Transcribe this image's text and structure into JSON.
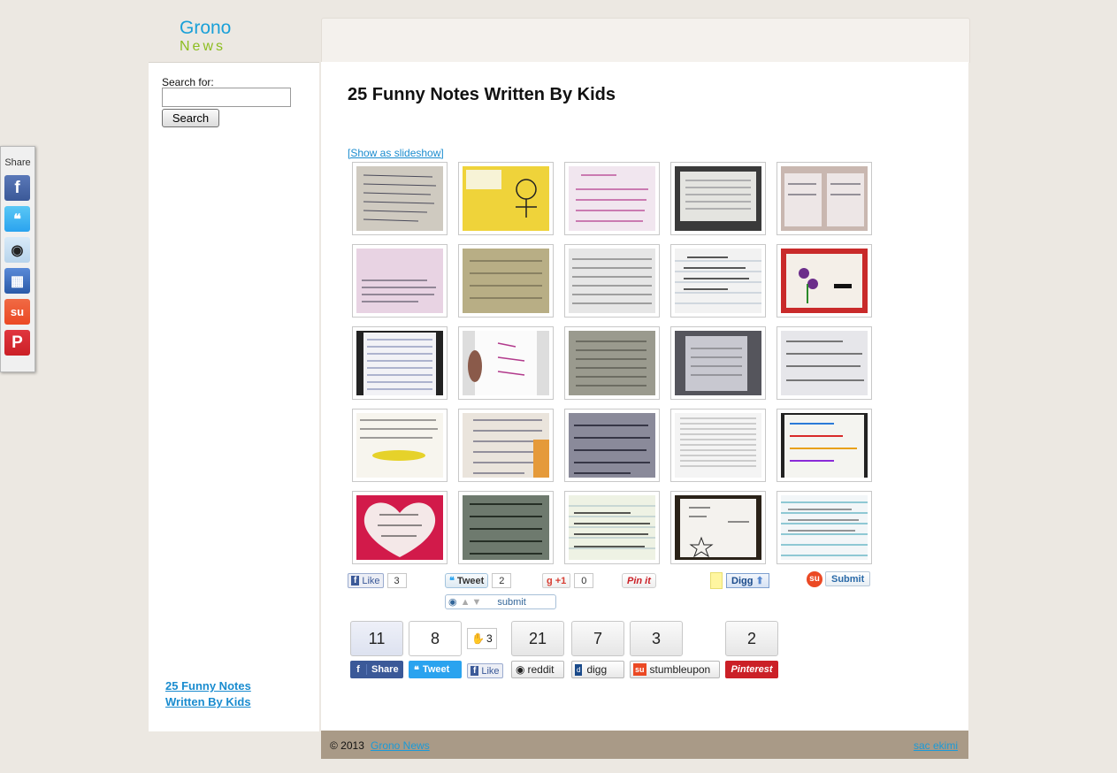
{
  "site": {
    "logo_line1": "Grono",
    "logo_line2": "News"
  },
  "search": {
    "label": "Search for:",
    "value": "",
    "button": "Search"
  },
  "sidebar": {
    "article_link": "25 Funny Notes Written By Kids"
  },
  "article": {
    "title": "25 Funny Notes Written By Kids",
    "slideshow_link": "[Show as slideshow]"
  },
  "share_rail": {
    "label": "Share",
    "icons": [
      "facebook-icon",
      "twitter-icon",
      "reddit-icon",
      "delicious-icon",
      "stumbleupon-icon",
      "pinterest-icon"
    ]
  },
  "social_row1": {
    "fb_like": "Like",
    "fb_count": "3",
    "tweet": "Tweet",
    "tweet_count": "2",
    "gplus": "+1",
    "gplus_count": "0",
    "pinit": "Pin it",
    "digg": "Digg",
    "stumble": "Submit",
    "reddit": "submit"
  },
  "social_row2": {
    "counts": [
      "11",
      "8",
      "3",
      "21",
      "7",
      "3",
      "2"
    ],
    "labels": {
      "facebook": "Share",
      "twitter": "Tweet",
      "like": "Like",
      "reddit": "reddit",
      "digg": "digg",
      "stumble": "stumbleupon",
      "pinterest": "Pinterest"
    }
  },
  "footer": {
    "copyright": "© 2013",
    "site_link": "Grono News",
    "right_link": "sac ekimi"
  },
  "colors": {
    "background": "#ece8e2",
    "link": "#1a8ccf",
    "logo_blue": "#1aa0d8",
    "logo_green": "#8cbd1f",
    "footer": "#a99a87"
  }
}
